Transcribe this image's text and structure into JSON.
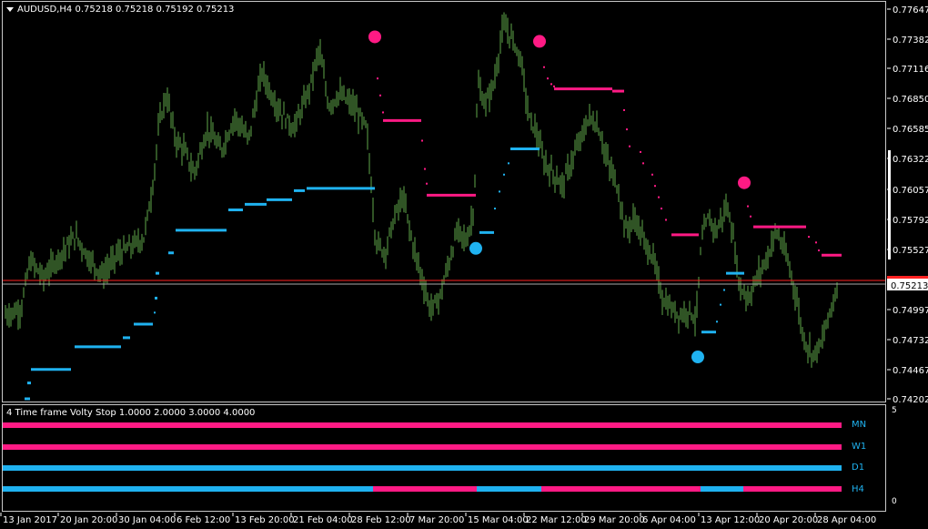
{
  "header": {
    "menu_icon": "triangle-down-icon",
    "title": "AUDUSD,H4  0.75218 0.75218 0.75192 0.75213"
  },
  "price_axis": {
    "labels": [
      "0.77647",
      "0.77382",
      "0.77116",
      "0.76850",
      "0.76585",
      "0.76322",
      "0.76057",
      "0.75792",
      "0.75527",
      "0.75213",
      "0.74997",
      "0.74732",
      "0.74467",
      "0.74202"
    ],
    "current_price": "0.75213"
  },
  "indicator": {
    "title": "4 Time frame Volty Stop 1.0000 2.0000 3.0000 4.0000",
    "axis_top": "5",
    "axis_bottom": "0",
    "rows": [
      {
        "label": "MN"
      },
      {
        "label": "W1"
      },
      {
        "label": "D1"
      },
      {
        "label": "H4"
      }
    ]
  },
  "time_axis": {
    "labels": [
      "13 Jan 2017",
      "20 Jan 20:00",
      "30 Jan 04:00",
      "6 Feb 12:00",
      "13 Feb 20:00",
      "21 Feb 04:00",
      "28 Feb 12:00",
      "7 Mar 20:00",
      "15 Mar 04:00",
      "22 Mar 12:00",
      "29 Mar 20:00",
      "6 Apr 04:00",
      "13 Apr 12:00",
      "20 Apr 20:00",
      "28 Apr 04:00"
    ]
  },
  "colors": {
    "bars": "#5fa84a",
    "bull_stop": "#1fb2f0",
    "bear_stop": "#ff1a84",
    "current_line": "#ff2222",
    "grid_text": "#ffffff"
  }
}
